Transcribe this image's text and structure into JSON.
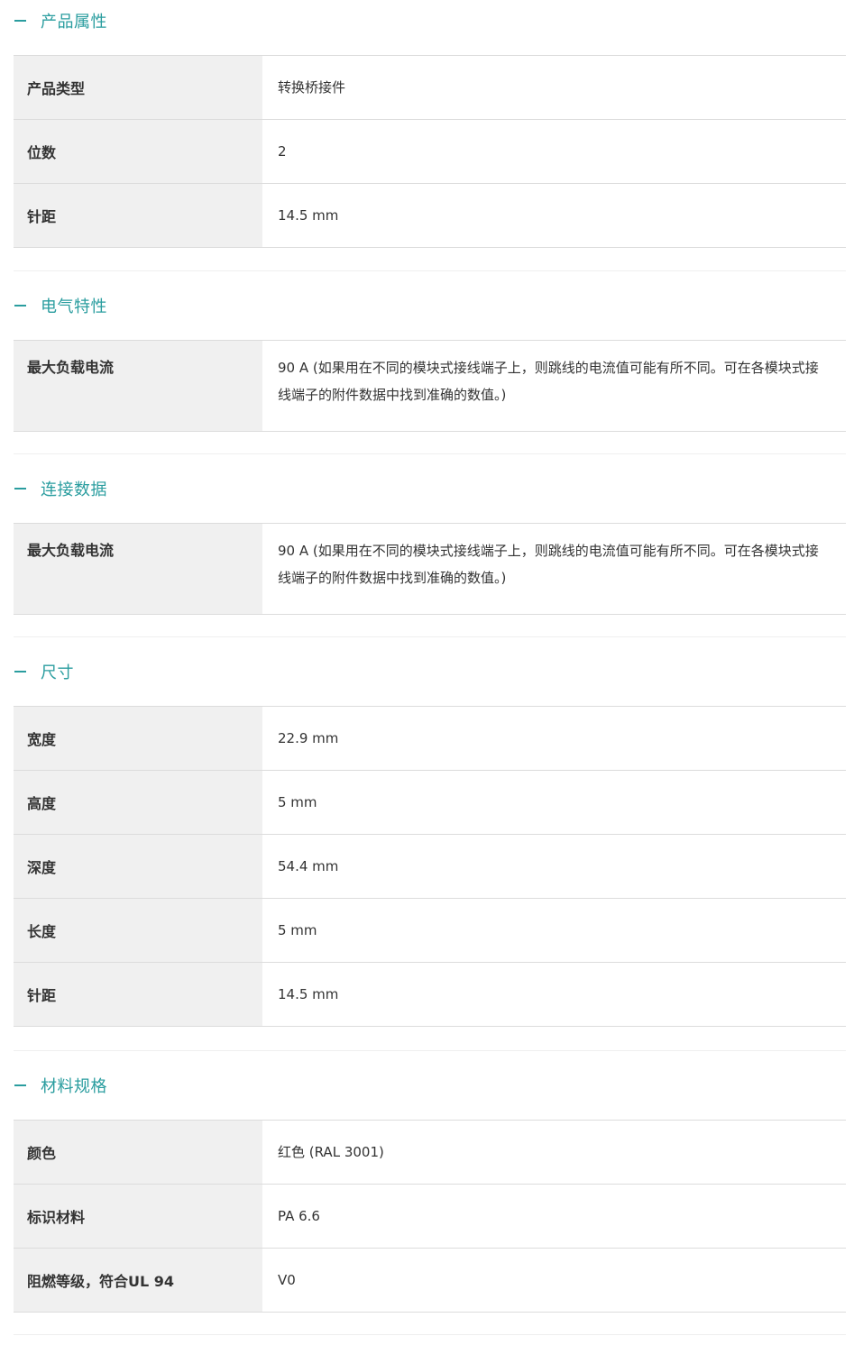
{
  "sections": [
    {
      "title": "产品属性",
      "rows": [
        {
          "label": "产品类型",
          "value": "转换桥接件"
        },
        {
          "label": "位数",
          "value": "2"
        },
        {
          "label": "针距",
          "value": "14.5 mm"
        }
      ]
    },
    {
      "title": "电气特性",
      "rows": [
        {
          "label": "最大负载电流",
          "value": "90 A (如果用在不同的模块式接线端子上，则跳线的电流值可能有所不同。可在各模块式接线端子的附件数据中找到准确的数值。)"
        }
      ]
    },
    {
      "title": "连接数据",
      "rows": [
        {
          "label": "最大负载电流",
          "value": "90 A (如果用在不同的模块式接线端子上，则跳线的电流值可能有所不同。可在各模块式接线端子的附件数据中找到准确的数值。)"
        }
      ]
    },
    {
      "title": "尺寸",
      "rows": [
        {
          "label": "宽度",
          "value": "22.9 mm"
        },
        {
          "label": "高度",
          "value": "5 mm"
        },
        {
          "label": "深度",
          "value": "54.4 mm"
        },
        {
          "label": "长度",
          "value": "5 mm"
        },
        {
          "label": "针距",
          "value": "14.5 mm"
        }
      ]
    },
    {
      "title": "材料规格",
      "rows": [
        {
          "label": "颜色",
          "value": "红色 (RAL 3001)"
        },
        {
          "label": "标识材料",
          "value": "PA 6.6"
        },
        {
          "label": "阻燃等级，符合UL 94",
          "value": "V0"
        }
      ]
    }
  ],
  "icons": {
    "collapse": "minus-icon"
  },
  "colors": {
    "accent": "#2a9d9f",
    "label_bg": "#f0f0f0",
    "border": "#dcdcdc"
  }
}
